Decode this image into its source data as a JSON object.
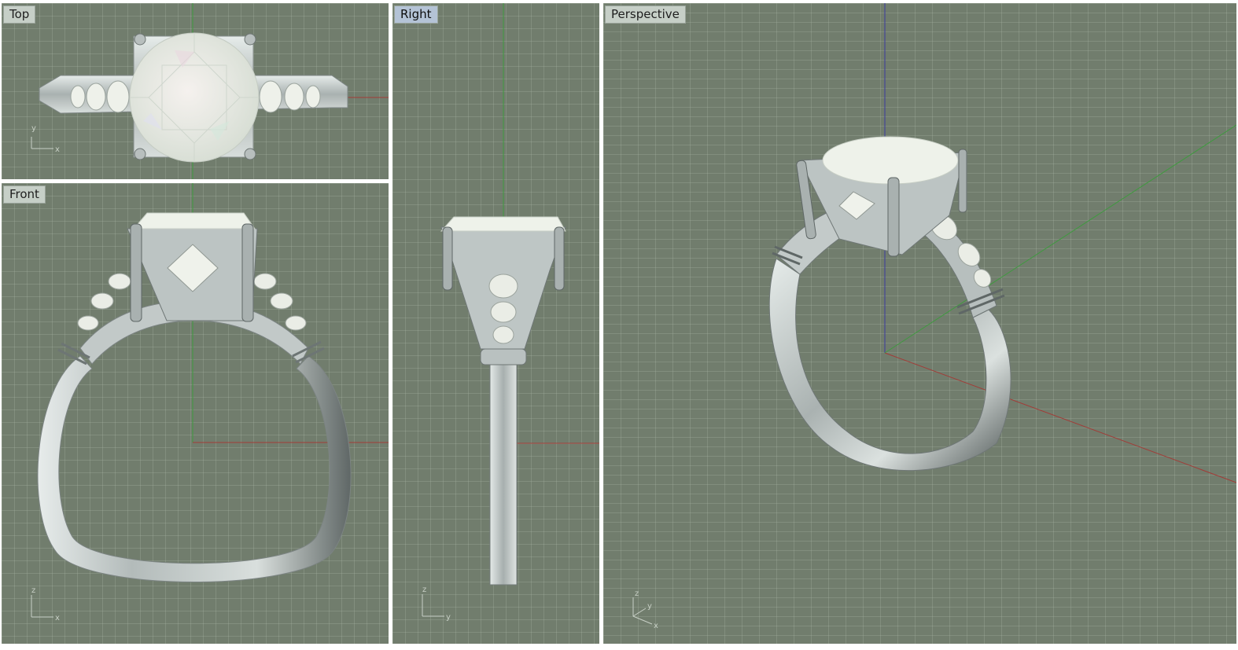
{
  "viewports": {
    "top": {
      "label": "Top",
      "axes": {
        "h": "x",
        "v": "y"
      }
    },
    "front": {
      "label": "Front",
      "axes": {
        "h": "x",
        "v": "z"
      }
    },
    "right": {
      "label": "Right",
      "axes": {
        "h": "y",
        "v": "z"
      },
      "active": true
    },
    "perspective": {
      "label": "Perspective",
      "axes": {
        "a": "x",
        "b": "y",
        "c": "z"
      }
    }
  },
  "colors": {
    "viewport_bg": "#717d6d",
    "grid": "#8a9586",
    "x_axis": "#a33a36",
    "y_axis": "#3f9a3f",
    "z_axis": "#3b3b9e",
    "metal": "#c9d0cf",
    "stone": "#eef2ea",
    "label_bg": "#c6cfc7",
    "active_label_bg": "#b4c3d6"
  }
}
